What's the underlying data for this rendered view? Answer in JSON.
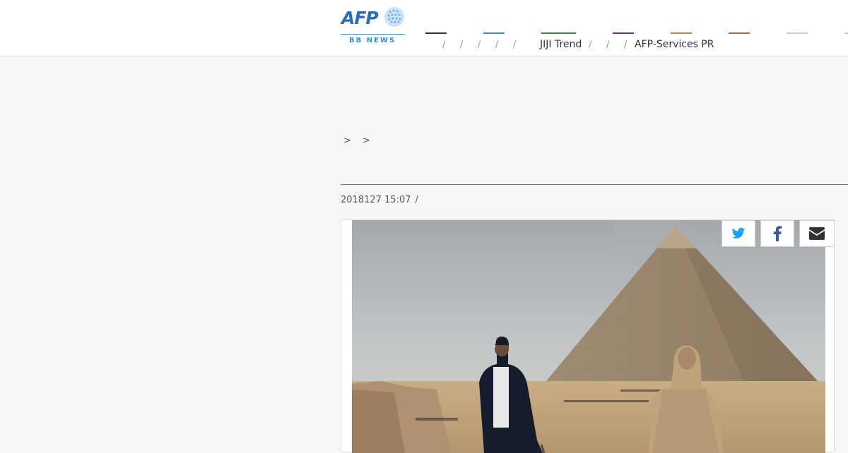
{
  "header": {
    "logo_text": "AFP",
    "logo_sub": "BB NEWS",
    "nav_slashes": [
      "/",
      "/",
      "/",
      "/",
      "/",
      "/",
      "/",
      "/"
    ],
    "nav_labels": [
      "JIJI Trend",
      "AFP-Services PR"
    ],
    "nav_colors": [
      "#333333",
      "#2a9bd6",
      "#2e8b3e",
      "#7b2c8f",
      "#d97a2a",
      "#c8661f",
      "#cccccc"
    ]
  },
  "article": {
    "breadcrumb": "> >",
    "title": "",
    "date": "2018127 15:07",
    "date_sep": "/"
  },
  "share": {
    "twitter_icon": "twitter-icon",
    "facebook_icon": "facebook-icon",
    "mail_icon": "mail-icon",
    "twitter_color": "#1da1f2",
    "facebook_color": "#3b5998",
    "mail_color": "#333333"
  }
}
